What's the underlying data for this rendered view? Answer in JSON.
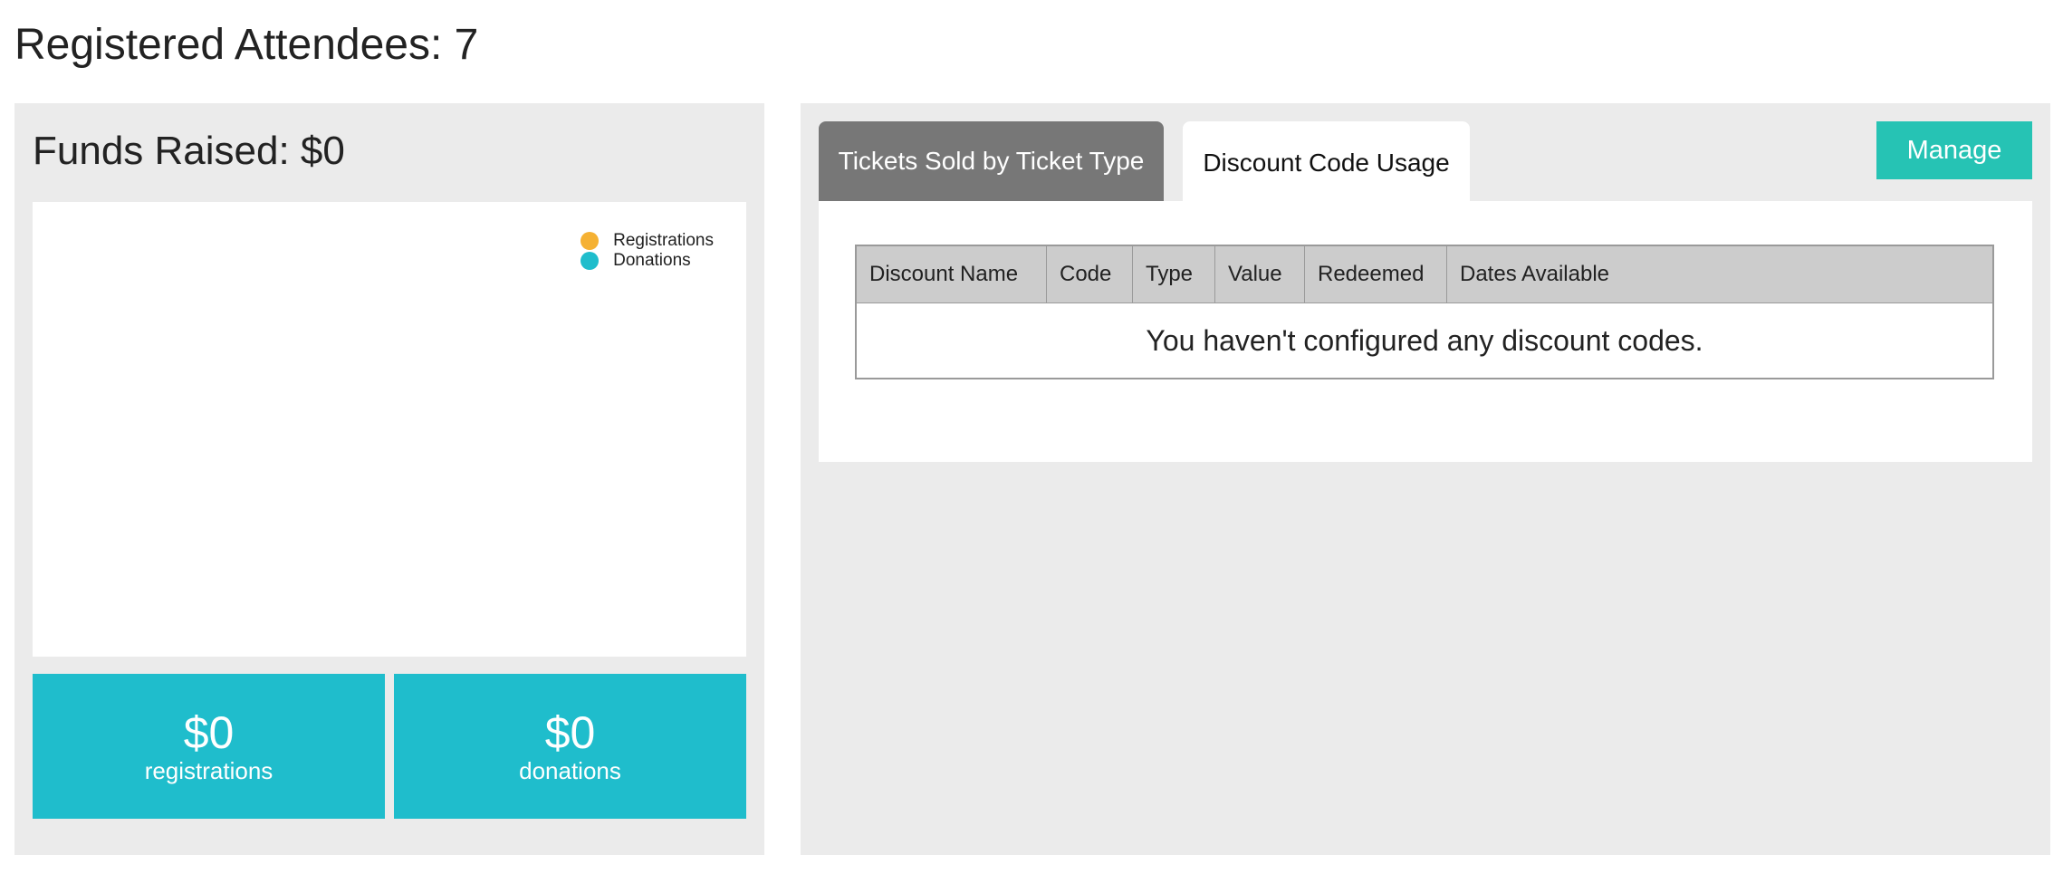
{
  "header": {
    "attendees_title": "Registered Attendees: 7"
  },
  "funds": {
    "title": "Funds Raised: $0",
    "legend": [
      {
        "label": "Registrations",
        "color": "#f5b133",
        "icon": "legend-dot"
      },
      {
        "label": "Donations",
        "color": "#1fbdcc",
        "icon": "legend-dot"
      }
    ],
    "tiles": {
      "registrations": {
        "value": "$0",
        "label": "registrations"
      },
      "donations": {
        "value": "$0",
        "label": "donations"
      }
    }
  },
  "tabs": [
    {
      "label": "Tickets Sold by Ticket Type",
      "active": false
    },
    {
      "label": "Discount Code Usage",
      "active": true
    }
  ],
  "toolbar": {
    "manage_label": "Manage"
  },
  "discount_table": {
    "columns": [
      "Discount Name",
      "Code",
      "Type",
      "Value",
      "Redeemed",
      "Dates Available"
    ],
    "empty_message": "You haven't configured any discount codes."
  },
  "colors": {
    "accent_teal": "#1fbdcc",
    "manage_button": "#26c3b4",
    "registrations": "#f5b133",
    "panel_bg": "#ebebeb",
    "inactive_tab": "#777777"
  }
}
